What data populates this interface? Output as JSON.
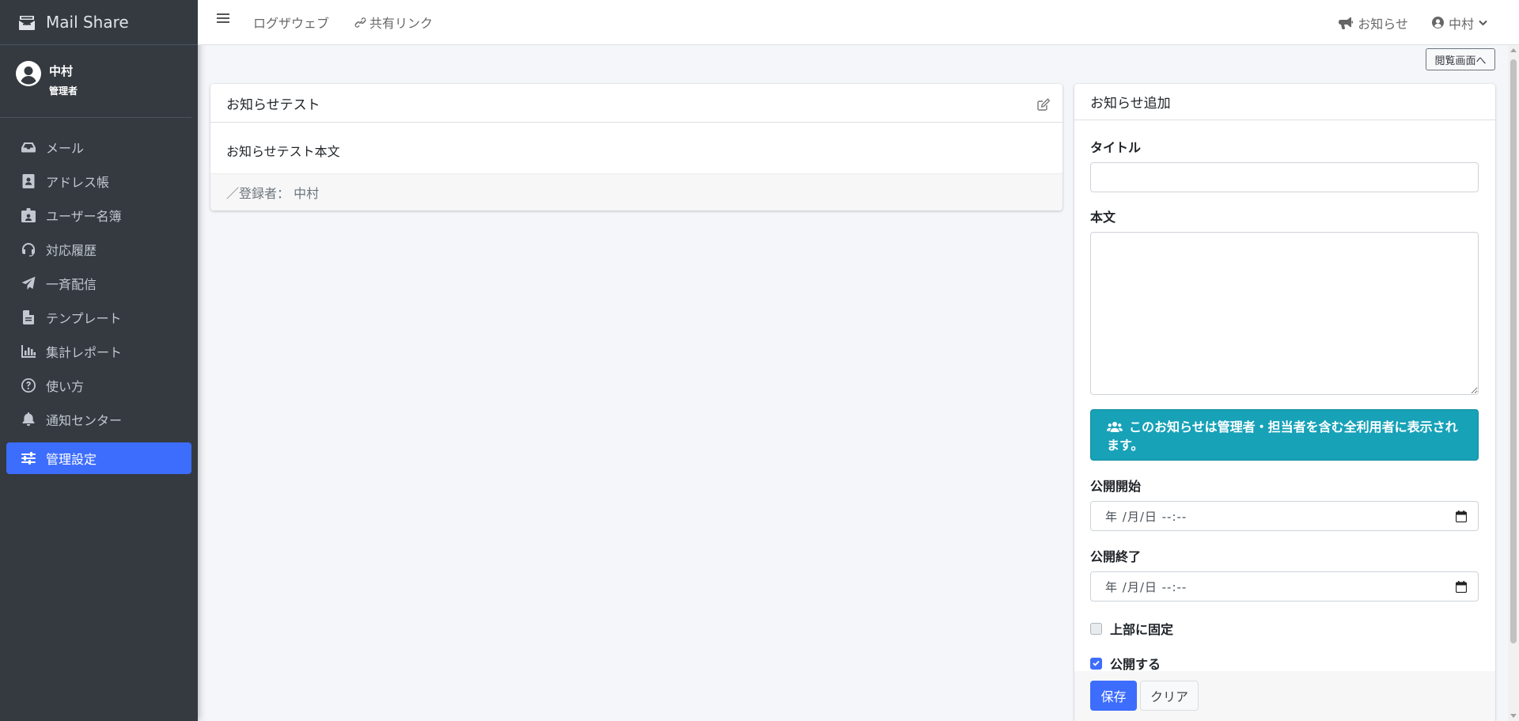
{
  "brand": {
    "title": "Mail Share",
    "icon": "envelope-open-icon"
  },
  "user": {
    "name": "中村",
    "role": "管理者"
  },
  "sidebar": {
    "items": [
      {
        "label": "メール",
        "icon": "inbox-icon"
      },
      {
        "label": "アドレス帳",
        "icon": "address-book-icon"
      },
      {
        "label": "ユーザー名簿",
        "icon": "id-badge-icon"
      },
      {
        "label": "対応履歴",
        "icon": "headset-icon"
      },
      {
        "label": "一斉配信",
        "icon": "paper-plane-icon"
      },
      {
        "label": "テンプレート",
        "icon": "file-alt-icon"
      },
      {
        "label": "集計レポート",
        "icon": "chart-bar-icon"
      },
      {
        "label": "使い方",
        "icon": "question-circle-icon"
      },
      {
        "label": "通知センター",
        "icon": "bell-icon"
      },
      {
        "label": "管理設定",
        "icon": "sliders-icon",
        "active": true
      }
    ]
  },
  "topbar": {
    "logweb": "ログザウェブ",
    "share_link": "共有リンク",
    "notice": "お知らせ",
    "user": "中村"
  },
  "view_button": "閲覧画面へ",
  "notice_card": {
    "title": "お知らせテスト",
    "body": "お知らせテスト本文",
    "footer": "／登録者： 中村"
  },
  "form": {
    "header": "お知らせ追加",
    "title_label": "タイトル",
    "title_value": "",
    "body_label": "本文",
    "body_value": "",
    "info": "このお知らせは管理者・担当者を含む全利用者に表示されます。",
    "start_label": "公開開始",
    "start_placeholder": "年 /月/日 --:--",
    "end_label": "公開終了",
    "end_placeholder": "年 /月/日 --:--",
    "pin_label": "上部に固定",
    "pin_checked": false,
    "publish_label": "公開する",
    "publish_checked": true,
    "save": "保存",
    "clear": "クリア"
  },
  "colors": {
    "sidebar_bg": "#343a40",
    "accent": "#3d6dfc",
    "info": "#17a2b8"
  }
}
